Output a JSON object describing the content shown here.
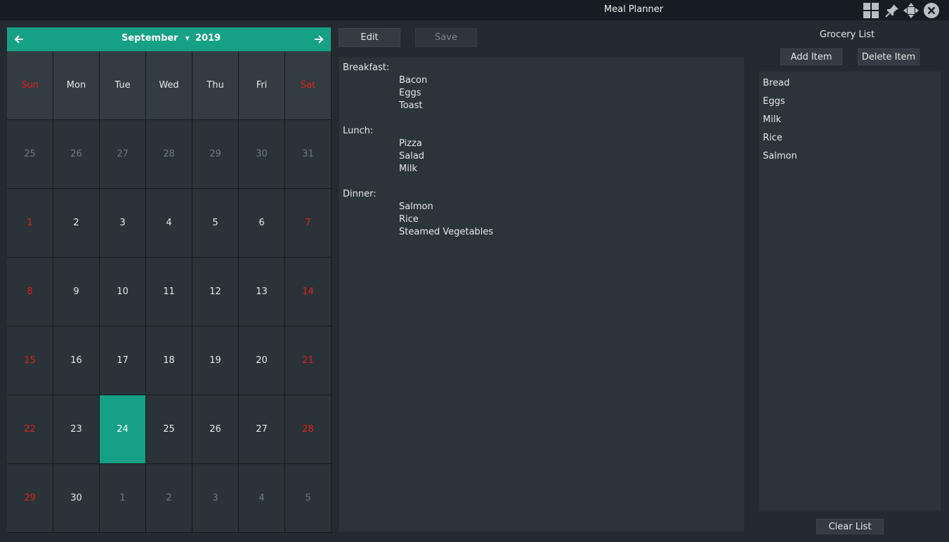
{
  "window": {
    "title": "Meal Planner"
  },
  "calendar": {
    "month": "September",
    "year": "2019",
    "weekdays": [
      "Sun",
      "Mon",
      "Tue",
      "Wed",
      "Thu",
      "Fri",
      "Sat"
    ],
    "weeks": [
      [
        "25",
        "26",
        "27",
        "28",
        "29",
        "30",
        "31"
      ],
      [
        "1",
        "2",
        "3",
        "4",
        "5",
        "6",
        "7"
      ],
      [
        "8",
        "9",
        "10",
        "11",
        "12",
        "13",
        "14"
      ],
      [
        "15",
        "16",
        "17",
        "18",
        "19",
        "20",
        "21"
      ],
      [
        "22",
        "23",
        "24",
        "25",
        "26",
        "27",
        "28"
      ],
      [
        "29",
        "30",
        "1",
        "2",
        "3",
        "4",
        "5"
      ]
    ],
    "selected_day": "24",
    "accent_color": "#16a085",
    "weekend_color": "#e0201c"
  },
  "toolbar": {
    "edit_label": "Edit",
    "save_label": "Save"
  },
  "meals": [
    {
      "label": "Breakfast:",
      "items": [
        "Bacon",
        "Eggs",
        "Toast"
      ]
    },
    {
      "label": "Lunch:",
      "items": [
        "Pizza",
        "Salad",
        "Milk"
      ]
    },
    {
      "label": "Dinner:",
      "items": [
        "Salmon",
        "Rice",
        "Steamed Vegetables"
      ]
    }
  ],
  "grocery": {
    "title": "Grocery List",
    "add_label": "Add Item",
    "delete_label": "Delete Item",
    "clear_label": "Clear List",
    "items": [
      "Bread",
      "Eggs",
      "Milk",
      "Rice",
      "Salmon"
    ]
  }
}
